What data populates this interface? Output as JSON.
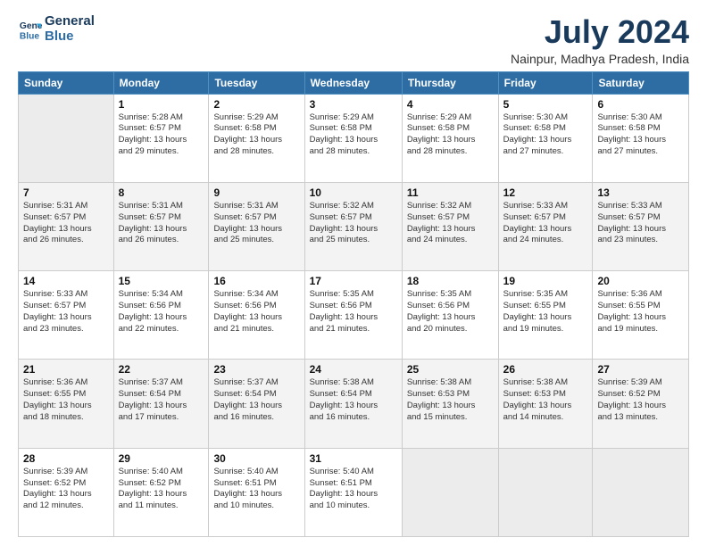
{
  "header": {
    "logo_line1": "General",
    "logo_line2": "Blue",
    "title": "July 2024",
    "subtitle": "Nainpur, Madhya Pradesh, India"
  },
  "days_of_week": [
    "Sunday",
    "Monday",
    "Tuesday",
    "Wednesday",
    "Thursday",
    "Friday",
    "Saturday"
  ],
  "weeks": [
    [
      {
        "day": "",
        "info": ""
      },
      {
        "day": "1",
        "info": "Sunrise: 5:28 AM\nSunset: 6:57 PM\nDaylight: 13 hours\nand 29 minutes."
      },
      {
        "day": "2",
        "info": "Sunrise: 5:29 AM\nSunset: 6:58 PM\nDaylight: 13 hours\nand 28 minutes."
      },
      {
        "day": "3",
        "info": "Sunrise: 5:29 AM\nSunset: 6:58 PM\nDaylight: 13 hours\nand 28 minutes."
      },
      {
        "day": "4",
        "info": "Sunrise: 5:29 AM\nSunset: 6:58 PM\nDaylight: 13 hours\nand 28 minutes."
      },
      {
        "day": "5",
        "info": "Sunrise: 5:30 AM\nSunset: 6:58 PM\nDaylight: 13 hours\nand 27 minutes."
      },
      {
        "day": "6",
        "info": "Sunrise: 5:30 AM\nSunset: 6:58 PM\nDaylight: 13 hours\nand 27 minutes."
      }
    ],
    [
      {
        "day": "7",
        "info": "Sunrise: 5:31 AM\nSunset: 6:57 PM\nDaylight: 13 hours\nand 26 minutes."
      },
      {
        "day": "8",
        "info": "Sunrise: 5:31 AM\nSunset: 6:57 PM\nDaylight: 13 hours\nand 26 minutes."
      },
      {
        "day": "9",
        "info": "Sunrise: 5:31 AM\nSunset: 6:57 PM\nDaylight: 13 hours\nand 25 minutes."
      },
      {
        "day": "10",
        "info": "Sunrise: 5:32 AM\nSunset: 6:57 PM\nDaylight: 13 hours\nand 25 minutes."
      },
      {
        "day": "11",
        "info": "Sunrise: 5:32 AM\nSunset: 6:57 PM\nDaylight: 13 hours\nand 24 minutes."
      },
      {
        "day": "12",
        "info": "Sunrise: 5:33 AM\nSunset: 6:57 PM\nDaylight: 13 hours\nand 24 minutes."
      },
      {
        "day": "13",
        "info": "Sunrise: 5:33 AM\nSunset: 6:57 PM\nDaylight: 13 hours\nand 23 minutes."
      }
    ],
    [
      {
        "day": "14",
        "info": "Sunrise: 5:33 AM\nSunset: 6:57 PM\nDaylight: 13 hours\nand 23 minutes."
      },
      {
        "day": "15",
        "info": "Sunrise: 5:34 AM\nSunset: 6:56 PM\nDaylight: 13 hours\nand 22 minutes."
      },
      {
        "day": "16",
        "info": "Sunrise: 5:34 AM\nSunset: 6:56 PM\nDaylight: 13 hours\nand 21 minutes."
      },
      {
        "day": "17",
        "info": "Sunrise: 5:35 AM\nSunset: 6:56 PM\nDaylight: 13 hours\nand 21 minutes."
      },
      {
        "day": "18",
        "info": "Sunrise: 5:35 AM\nSunset: 6:56 PM\nDaylight: 13 hours\nand 20 minutes."
      },
      {
        "day": "19",
        "info": "Sunrise: 5:35 AM\nSunset: 6:55 PM\nDaylight: 13 hours\nand 19 minutes."
      },
      {
        "day": "20",
        "info": "Sunrise: 5:36 AM\nSunset: 6:55 PM\nDaylight: 13 hours\nand 19 minutes."
      }
    ],
    [
      {
        "day": "21",
        "info": "Sunrise: 5:36 AM\nSunset: 6:55 PM\nDaylight: 13 hours\nand 18 minutes."
      },
      {
        "day": "22",
        "info": "Sunrise: 5:37 AM\nSunset: 6:54 PM\nDaylight: 13 hours\nand 17 minutes."
      },
      {
        "day": "23",
        "info": "Sunrise: 5:37 AM\nSunset: 6:54 PM\nDaylight: 13 hours\nand 16 minutes."
      },
      {
        "day": "24",
        "info": "Sunrise: 5:38 AM\nSunset: 6:54 PM\nDaylight: 13 hours\nand 16 minutes."
      },
      {
        "day": "25",
        "info": "Sunrise: 5:38 AM\nSunset: 6:53 PM\nDaylight: 13 hours\nand 15 minutes."
      },
      {
        "day": "26",
        "info": "Sunrise: 5:38 AM\nSunset: 6:53 PM\nDaylight: 13 hours\nand 14 minutes."
      },
      {
        "day": "27",
        "info": "Sunrise: 5:39 AM\nSunset: 6:52 PM\nDaylight: 13 hours\nand 13 minutes."
      }
    ],
    [
      {
        "day": "28",
        "info": "Sunrise: 5:39 AM\nSunset: 6:52 PM\nDaylight: 13 hours\nand 12 minutes."
      },
      {
        "day": "29",
        "info": "Sunrise: 5:40 AM\nSunset: 6:52 PM\nDaylight: 13 hours\nand 11 minutes."
      },
      {
        "day": "30",
        "info": "Sunrise: 5:40 AM\nSunset: 6:51 PM\nDaylight: 13 hours\nand 10 minutes."
      },
      {
        "day": "31",
        "info": "Sunrise: 5:40 AM\nSunset: 6:51 PM\nDaylight: 13 hours\nand 10 minutes."
      },
      {
        "day": "",
        "info": ""
      },
      {
        "day": "",
        "info": ""
      },
      {
        "day": "",
        "info": ""
      }
    ]
  ]
}
